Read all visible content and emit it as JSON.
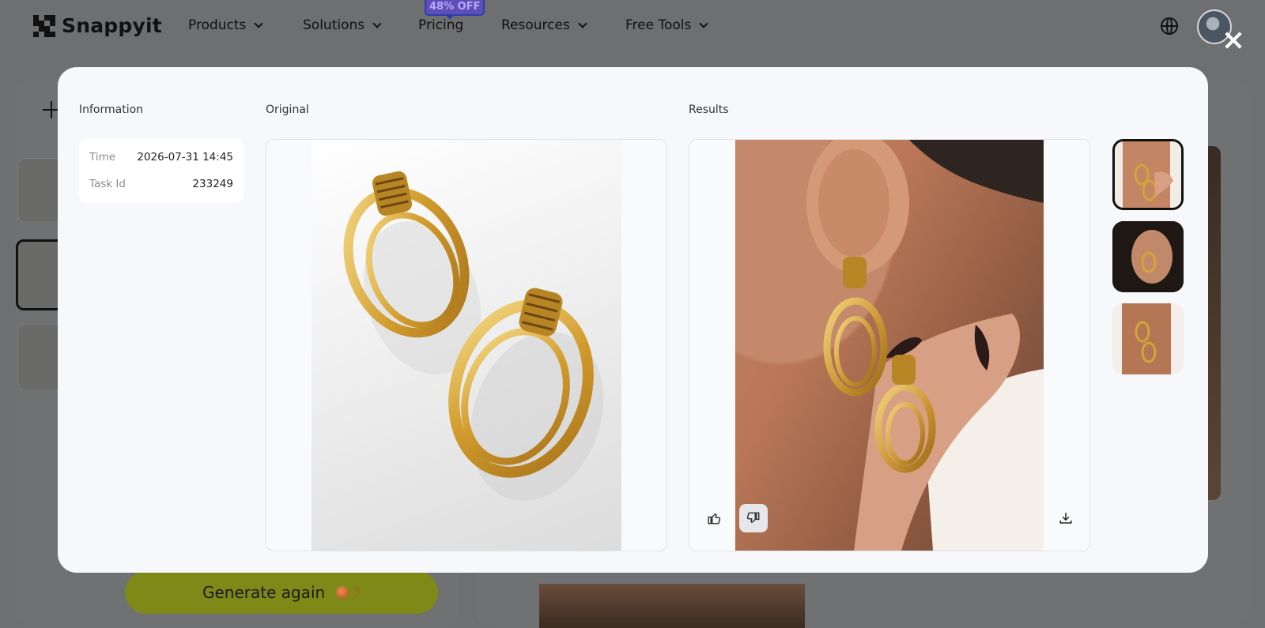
{
  "nav": {
    "brand": "Snappyit",
    "items": [
      {
        "label": "Products"
      },
      {
        "label": "Solutions"
      },
      {
        "label": "Pricing",
        "badge": "48% OFF"
      },
      {
        "label": "Resources"
      },
      {
        "label": "Free Tools"
      }
    ],
    "language_icon": "globe-icon",
    "avatar": "user-avatar"
  },
  "background": {
    "generate_label": "Generate again",
    "credits": "3"
  },
  "modal": {
    "information_title": "Information",
    "original_title": "Original",
    "results_title": "Results",
    "info": [
      {
        "key": "Time",
        "value": "2026-07-31 14:45"
      },
      {
        "key": "Task Id",
        "value": "233249"
      }
    ],
    "feedback": {
      "like_icon": "thumbs-up-icon",
      "dislike_icon": "thumbs-down-icon",
      "download_icon": "download-icon"
    },
    "result_thumbnails": 3,
    "selected_thumbnail": 1
  },
  "colors": {
    "overlay": "#6e6f71",
    "modal_bg": "#f7f8fc",
    "generate_button": "#7d8a18",
    "badge": "#5d4fb3"
  }
}
